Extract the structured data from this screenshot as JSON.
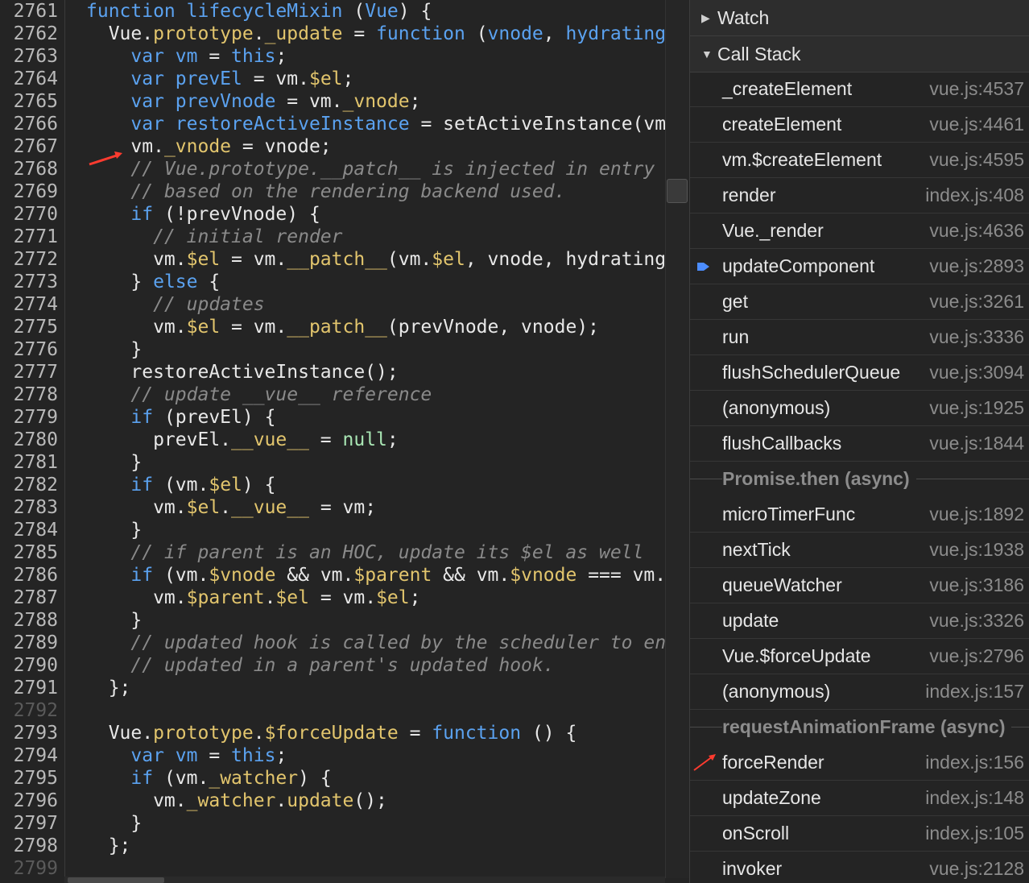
{
  "editor": {
    "gutter": [
      {
        "n": "2761",
        "dim": false
      },
      {
        "n": "2762",
        "dim": false
      },
      {
        "n": "2763",
        "dim": false
      },
      {
        "n": "2764",
        "dim": false
      },
      {
        "n": "2765",
        "dim": false
      },
      {
        "n": "2766",
        "dim": false
      },
      {
        "n": "2767",
        "dim": false
      },
      {
        "n": "2768",
        "dim": false
      },
      {
        "n": "2769",
        "dim": false
      },
      {
        "n": "2770",
        "dim": false
      },
      {
        "n": "2771",
        "dim": false
      },
      {
        "n": "2772",
        "dim": false
      },
      {
        "n": "2773",
        "dim": false
      },
      {
        "n": "2774",
        "dim": false
      },
      {
        "n": "2775",
        "dim": false
      },
      {
        "n": "2776",
        "dim": false
      },
      {
        "n": "2777",
        "dim": false
      },
      {
        "n": "2778",
        "dim": false
      },
      {
        "n": "2779",
        "dim": false
      },
      {
        "n": "2780",
        "dim": false
      },
      {
        "n": "2781",
        "dim": false
      },
      {
        "n": "2782",
        "dim": false
      },
      {
        "n": "2783",
        "dim": false
      },
      {
        "n": "2784",
        "dim": false
      },
      {
        "n": "2785",
        "dim": false
      },
      {
        "n": "2786",
        "dim": false
      },
      {
        "n": "2787",
        "dim": false
      },
      {
        "n": "2788",
        "dim": false
      },
      {
        "n": "2789",
        "dim": false
      },
      {
        "n": "2790",
        "dim": false
      },
      {
        "n": "2791",
        "dim": false
      },
      {
        "n": "2792",
        "dim": true
      },
      {
        "n": "2793",
        "dim": false
      },
      {
        "n": "2794",
        "dim": false
      },
      {
        "n": "2795",
        "dim": false
      },
      {
        "n": "2796",
        "dim": false
      },
      {
        "n": "2797",
        "dim": false
      },
      {
        "n": "2798",
        "dim": false
      },
      {
        "n": "2799",
        "dim": true
      }
    ],
    "lines": [
      [
        [
          "k",
          "function"
        ],
        [
          "t",
          " "
        ],
        [
          "v",
          "lifecycleMixin"
        ],
        [
          "t",
          " ("
        ],
        [
          "v",
          "Vue"
        ],
        [
          "t",
          ") {"
        ]
      ],
      [
        [
          "t",
          "  Vue."
        ],
        [
          "p",
          "prototype"
        ],
        [
          "t",
          "."
        ],
        [
          "p",
          "_update"
        ],
        [
          "t",
          " = "
        ],
        [
          "k",
          "function"
        ],
        [
          "t",
          " ("
        ],
        [
          "v",
          "vnode"
        ],
        [
          "t",
          ", "
        ],
        [
          "v",
          "hydrating"
        ]
      ],
      [
        [
          "t",
          "    "
        ],
        [
          "k",
          "var"
        ],
        [
          "t",
          " "
        ],
        [
          "v",
          "vm"
        ],
        [
          "t",
          " = "
        ],
        [
          "k",
          "this"
        ],
        [
          "t",
          ";"
        ]
      ],
      [
        [
          "t",
          "    "
        ],
        [
          "k",
          "var"
        ],
        [
          "t",
          " "
        ],
        [
          "v",
          "prevEl"
        ],
        [
          "t",
          " = vm."
        ],
        [
          "p",
          "$el"
        ],
        [
          "t",
          ";"
        ]
      ],
      [
        [
          "t",
          "    "
        ],
        [
          "k",
          "var"
        ],
        [
          "t",
          " "
        ],
        [
          "v",
          "prevVnode"
        ],
        [
          "t",
          " = vm."
        ],
        [
          "p",
          "_vnode"
        ],
        [
          "t",
          ";"
        ]
      ],
      [
        [
          "t",
          "    "
        ],
        [
          "k",
          "var"
        ],
        [
          "t",
          " "
        ],
        [
          "v",
          "restoreActiveInstance"
        ],
        [
          "t",
          " = setActiveInstance(vm"
        ]
      ],
      [
        [
          "t",
          "    vm."
        ],
        [
          "p",
          "_vnode"
        ],
        [
          "t",
          " = vnode;"
        ]
      ],
      [
        [
          "t",
          "    "
        ],
        [
          "c",
          "// Vue.prototype.__patch__ is injected in entry"
        ]
      ],
      [
        [
          "t",
          "    "
        ],
        [
          "c",
          "// based on the rendering backend used."
        ]
      ],
      [
        [
          "t",
          "    "
        ],
        [
          "k",
          "if"
        ],
        [
          "t",
          " (!prevVnode) {"
        ]
      ],
      [
        [
          "t",
          "      "
        ],
        [
          "c",
          "// initial render"
        ]
      ],
      [
        [
          "t",
          "      vm."
        ],
        [
          "p",
          "$el"
        ],
        [
          "t",
          " = vm."
        ],
        [
          "p",
          "__patch__"
        ],
        [
          "t",
          "(vm."
        ],
        [
          "p",
          "$el"
        ],
        [
          "t",
          ", vnode, hydrating"
        ]
      ],
      [
        [
          "t",
          "    } "
        ],
        [
          "k",
          "else"
        ],
        [
          "t",
          " {"
        ]
      ],
      [
        [
          "t",
          "      "
        ],
        [
          "c",
          "// updates"
        ]
      ],
      [
        [
          "t",
          "      vm."
        ],
        [
          "p",
          "$el"
        ],
        [
          "t",
          " = vm."
        ],
        [
          "p",
          "__patch__"
        ],
        [
          "t",
          "(prevVnode, vnode);"
        ]
      ],
      [
        [
          "t",
          "    }"
        ]
      ],
      [
        [
          "t",
          "    restoreActiveInstance();"
        ]
      ],
      [
        [
          "t",
          "    "
        ],
        [
          "c",
          "// update __vue__ reference"
        ]
      ],
      [
        [
          "t",
          "    "
        ],
        [
          "k",
          "if"
        ],
        [
          "t",
          " (prevEl) {"
        ]
      ],
      [
        [
          "t",
          "      prevEl."
        ],
        [
          "p",
          "__vue__"
        ],
        [
          "t",
          " = "
        ],
        [
          "n",
          "null"
        ],
        [
          "t",
          ";"
        ]
      ],
      [
        [
          "t",
          "    }"
        ]
      ],
      [
        [
          "t",
          "    "
        ],
        [
          "k",
          "if"
        ],
        [
          "t",
          " (vm."
        ],
        [
          "p",
          "$el"
        ],
        [
          "t",
          ") {"
        ]
      ],
      [
        [
          "t",
          "      vm."
        ],
        [
          "p",
          "$el"
        ],
        [
          "t",
          "."
        ],
        [
          "p",
          "__vue__"
        ],
        [
          "t",
          " = vm;"
        ]
      ],
      [
        [
          "t",
          "    }"
        ]
      ],
      [
        [
          "t",
          "    "
        ],
        [
          "c",
          "// if parent is an HOC, update its $el as well"
        ]
      ],
      [
        [
          "t",
          "    "
        ],
        [
          "k",
          "if"
        ],
        [
          "t",
          " (vm."
        ],
        [
          "p",
          "$vnode"
        ],
        [
          "t",
          " && vm."
        ],
        [
          "p",
          "$parent"
        ],
        [
          "t",
          " && vm."
        ],
        [
          "p",
          "$vnode"
        ],
        [
          "t",
          " === vm."
        ]
      ],
      [
        [
          "t",
          "      vm."
        ],
        [
          "p",
          "$parent"
        ],
        [
          "t",
          "."
        ],
        [
          "p",
          "$el"
        ],
        [
          "t",
          " = vm."
        ],
        [
          "p",
          "$el"
        ],
        [
          "t",
          ";"
        ]
      ],
      [
        [
          "t",
          "    }"
        ]
      ],
      [
        [
          "t",
          "    "
        ],
        [
          "c",
          "// updated hook is called by the scheduler to en"
        ]
      ],
      [
        [
          "t",
          "    "
        ],
        [
          "c",
          "// updated in a parent's updated hook."
        ]
      ],
      [
        [
          "t",
          "  };"
        ]
      ],
      [
        [
          "t",
          ""
        ]
      ],
      [
        [
          "t",
          "  Vue."
        ],
        [
          "p",
          "prototype"
        ],
        [
          "t",
          "."
        ],
        [
          "p",
          "$forceUpdate"
        ],
        [
          "t",
          " = "
        ],
        [
          "k",
          "function"
        ],
        [
          "t",
          " () {"
        ]
      ],
      [
        [
          "t",
          "    "
        ],
        [
          "k",
          "var"
        ],
        [
          "t",
          " "
        ],
        [
          "v",
          "vm"
        ],
        [
          "t",
          " = "
        ],
        [
          "k",
          "this"
        ],
        [
          "t",
          ";"
        ]
      ],
      [
        [
          "t",
          "    "
        ],
        [
          "k",
          "if"
        ],
        [
          "t",
          " (vm."
        ],
        [
          "p",
          "_watcher"
        ],
        [
          "t",
          ") {"
        ]
      ],
      [
        [
          "t",
          "      vm."
        ],
        [
          "p",
          "_watcher"
        ],
        [
          "t",
          "."
        ],
        [
          "p",
          "update"
        ],
        [
          "t",
          "();"
        ]
      ],
      [
        [
          "t",
          "    }"
        ]
      ],
      [
        [
          "t",
          "  };"
        ]
      ],
      [
        [
          "t",
          ""
        ]
      ]
    ]
  },
  "panel": {
    "watch_label": "Watch",
    "callstack_label": "Call Stack",
    "colors": {
      "accent_blue": "#4c8dff",
      "annotation_red": "#ff3b2f"
    },
    "frames": [
      {
        "type": "frame",
        "name": "_createElement",
        "loc": "vue.js:4537"
      },
      {
        "type": "frame",
        "name": "createElement",
        "loc": "vue.js:4461"
      },
      {
        "type": "frame",
        "name": "vm.$createElement",
        "loc": "vue.js:4595"
      },
      {
        "type": "frame",
        "name": "render",
        "loc": "index.js:408"
      },
      {
        "type": "frame",
        "name": "Vue._render",
        "loc": "vue.js:4636"
      },
      {
        "type": "frame",
        "name": "updateComponent",
        "loc": "vue.js:2893",
        "current": true
      },
      {
        "type": "frame",
        "name": "get",
        "loc": "vue.js:3261"
      },
      {
        "type": "frame",
        "name": "run",
        "loc": "vue.js:3336"
      },
      {
        "type": "frame",
        "name": "flushSchedulerQueue",
        "loc": "vue.js:3094"
      },
      {
        "type": "frame",
        "name": "(anonymous)",
        "loc": "vue.js:1925"
      },
      {
        "type": "frame",
        "name": "flushCallbacks",
        "loc": "vue.js:1844"
      },
      {
        "type": "async",
        "name": "Promise.then (async)"
      },
      {
        "type": "frame",
        "name": "microTimerFunc",
        "loc": "vue.js:1892"
      },
      {
        "type": "frame",
        "name": "nextTick",
        "loc": "vue.js:1938"
      },
      {
        "type": "frame",
        "name": "queueWatcher",
        "loc": "vue.js:3186"
      },
      {
        "type": "frame",
        "name": "update",
        "loc": "vue.js:3326"
      },
      {
        "type": "frame",
        "name": "Vue.$forceUpdate",
        "loc": "vue.js:2796"
      },
      {
        "type": "frame",
        "name": "(anonymous)",
        "loc": "index.js:157"
      },
      {
        "type": "async",
        "name": "requestAnimationFrame (async)"
      },
      {
        "type": "frame",
        "name": "forceRender",
        "loc": "index.js:156",
        "annotated": true
      },
      {
        "type": "frame",
        "name": "updateZone",
        "loc": "index.js:148"
      },
      {
        "type": "frame",
        "name": "onScroll",
        "loc": "index.js:105"
      },
      {
        "type": "frame",
        "name": "invoker",
        "loc": "vue.js:2128"
      }
    ]
  }
}
